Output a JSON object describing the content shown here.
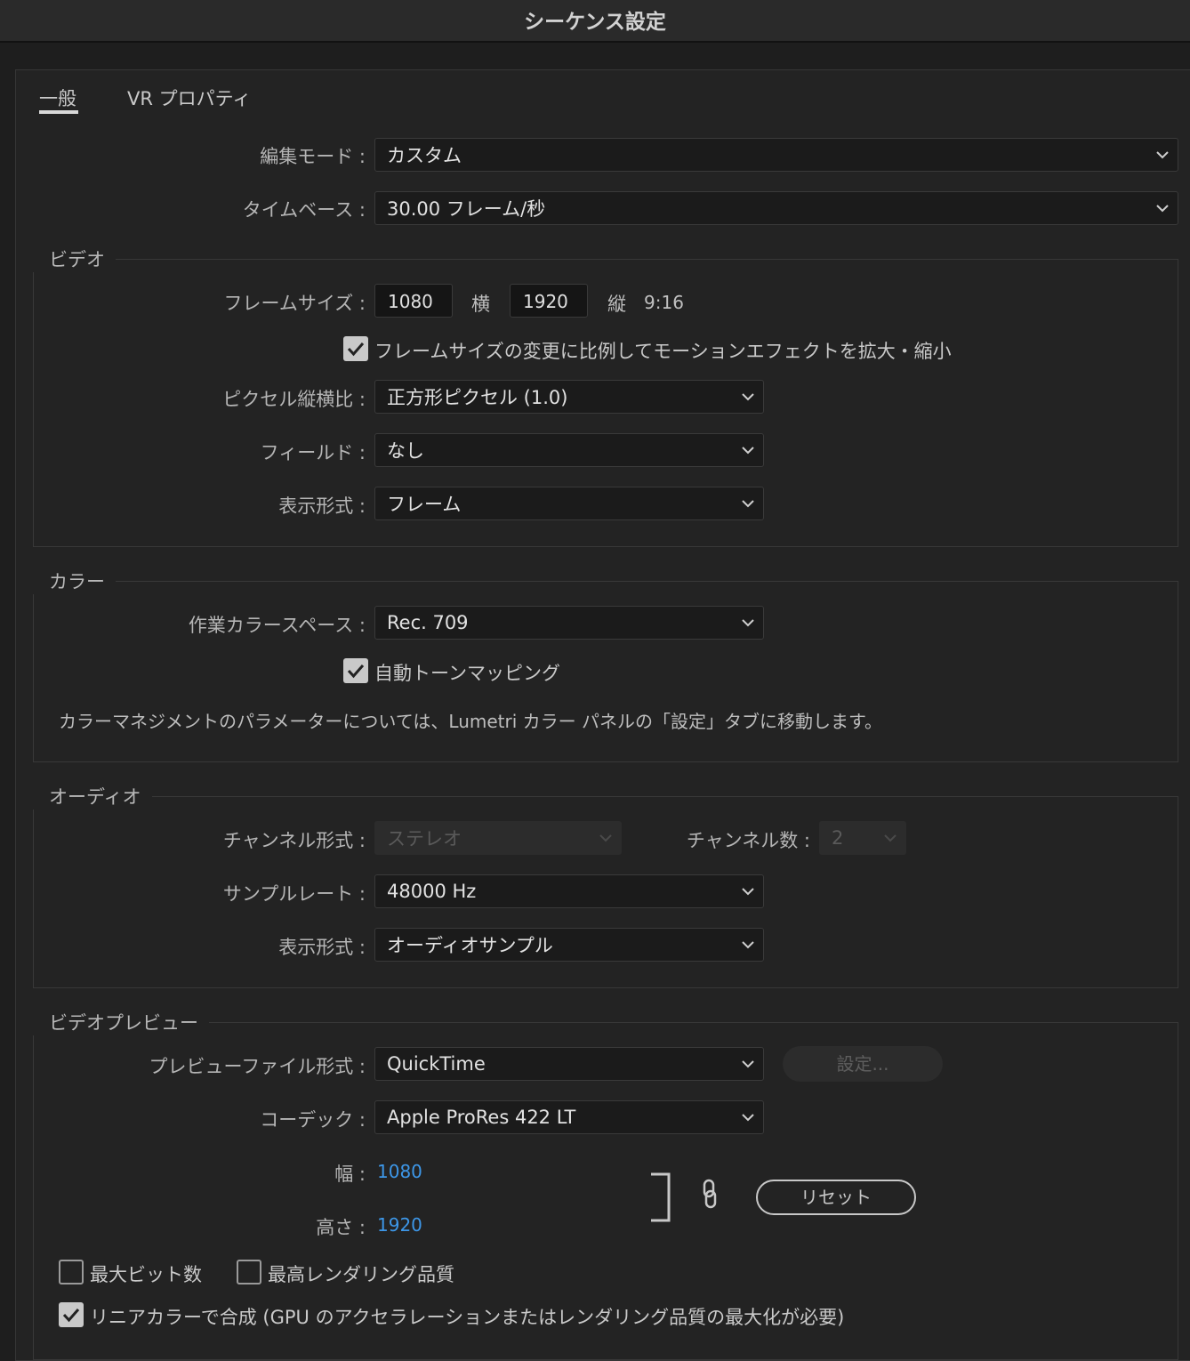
{
  "window": {
    "title": "シーケンス設定"
  },
  "tabs": [
    {
      "label": "一般"
    },
    {
      "label": "VR プロパティ"
    }
  ],
  "general": {
    "edit_mode": {
      "label": "編集モード :",
      "value": "カスタム"
    },
    "timebase": {
      "label": "タイムベース :",
      "value": "30.00 フレーム/秒"
    }
  },
  "video": {
    "title": "ビデオ",
    "frame_size": {
      "label": "フレームサイズ :",
      "width": "1080",
      "width_unit": "横",
      "height": "1920",
      "height_unit": "縦",
      "aspect": "9:16"
    },
    "scale_motion": {
      "label": "フレームサイズの変更に比例してモーションエフェクトを拡大・縮小",
      "checked": true
    },
    "pixel_aspect": {
      "label": "ピクセル縦横比 :",
      "value": "正方形ピクセル (1.0)"
    },
    "fields": {
      "label": "フィールド :",
      "value": "なし"
    },
    "display_format": {
      "label": "表示形式 :",
      "value": "フレーム"
    }
  },
  "color": {
    "title": "カラー",
    "working_space": {
      "label": "作業カラースペース :",
      "value": "Rec. 709"
    },
    "auto_tonemap": {
      "label": "自動トーンマッピング",
      "checked": true
    },
    "note": "カラーマネジメントのパラメーターについては、Lumetri カラー パネルの「設定」タブに移動します。"
  },
  "audio": {
    "title": "オーディオ",
    "channel_format": {
      "label": "チャンネル形式 :",
      "value": "ステレオ",
      "disabled": true
    },
    "channel_count": {
      "label": "チャンネル数 :",
      "value": "2",
      "disabled": true
    },
    "sample_rate": {
      "label": "サンプルレート :",
      "value": "48000 Hz"
    },
    "display_format": {
      "label": "表示形式 :",
      "value": "オーディオサンプル"
    }
  },
  "preview": {
    "title": "ビデオプレビュー",
    "file_format": {
      "label": "プレビューファイル形式 :",
      "value": "QuickTime"
    },
    "settings_button": "設定...",
    "codec": {
      "label": "コーデック :",
      "value": "Apple ProRes 422 LT"
    },
    "width": {
      "label": "幅 :",
      "value": "1080"
    },
    "height": {
      "label": "高さ :",
      "value": "1920"
    },
    "reset_button": "リセット",
    "max_bit_depth": {
      "label": "最大ビット数",
      "checked": false
    },
    "max_render_quality": {
      "label": "最高レンダリング品質",
      "checked": false
    },
    "linear_color": {
      "label": "リニアカラーで合成 (GPU のアクセラレーションまたはレンダリング品質の最大化が必要)",
      "checked": true
    }
  },
  "colors": {
    "accent_link": "#3d97e8",
    "background": "#232323",
    "field": "#1b1b1b"
  }
}
